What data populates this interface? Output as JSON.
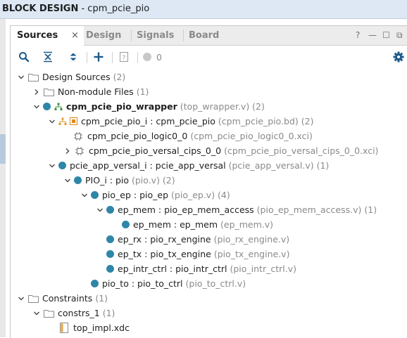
{
  "window": {
    "title_bold": "BLOCK DESIGN",
    "title_rest": " - cpm_pcie_pio"
  },
  "tabs": [
    {
      "label": "Sources",
      "active": true
    },
    {
      "label": "Design"
    },
    {
      "label": "Signals"
    },
    {
      "label": "Board"
    }
  ],
  "tab_close": "×",
  "window_controls": {
    "help": "?",
    "minimize": "—",
    "maximize": "☐",
    "restore": "⧉"
  },
  "toolbar": {
    "count": "0"
  },
  "tree": [
    {
      "label": "Design Sources",
      "sub": "(2)"
    },
    {
      "label": "Non-module Files",
      "sub": "(1)"
    },
    {
      "label": "cpm_pcie_pio_wrapper",
      "sub": "(top_wrapper.v) (2)"
    },
    {
      "label": "cpm_pcie_pio_i : cpm_pcie_pio",
      "sub": "(cpm_pcie_pio.bd) (2)"
    },
    {
      "label": "cpm_pcie_pio_logic0_0",
      "sub": "(cpm_pcie_pio_logic0_0.xci)"
    },
    {
      "label": "cpm_pcie_pio_versal_cips_0_0",
      "sub": "(cpm_pcie_pio_versal_cips_0_0.xci)"
    },
    {
      "label": "pcie_app_versal_i : pcie_app_versal",
      "sub": "(pcie_app_versal.v) (1)"
    },
    {
      "label": "PIO_i : pio",
      "sub": "(pio.v) (2)"
    },
    {
      "label": "pio_ep : pio_ep",
      "sub": "(pio_ep.v) (4)"
    },
    {
      "label": "ep_mem : pio_ep_mem_access",
      "sub": "(pio_ep_mem_access.v) (1)"
    },
    {
      "label": "ep_mem : ep_mem",
      "sub": "(ep_mem.v)"
    },
    {
      "label": "ep_rx : pio_rx_engine",
      "sub": "(pio_rx_engine.v)"
    },
    {
      "label": "ep_tx : pio_tx_engine",
      "sub": "(pio_tx_engine.v)"
    },
    {
      "label": "ep_intr_ctrl : pio_intr_ctrl",
      "sub": "(pio_intr_ctrl.v)"
    },
    {
      "label": "pio_to : pio_to_ctrl",
      "sub": "(pio_to_ctrl.v)"
    },
    {
      "label": "Constraints",
      "sub": "(1)"
    },
    {
      "label": "constrs_1",
      "sub": "(1)"
    },
    {
      "label": "top_impl.xdc",
      "sub": ""
    }
  ]
}
